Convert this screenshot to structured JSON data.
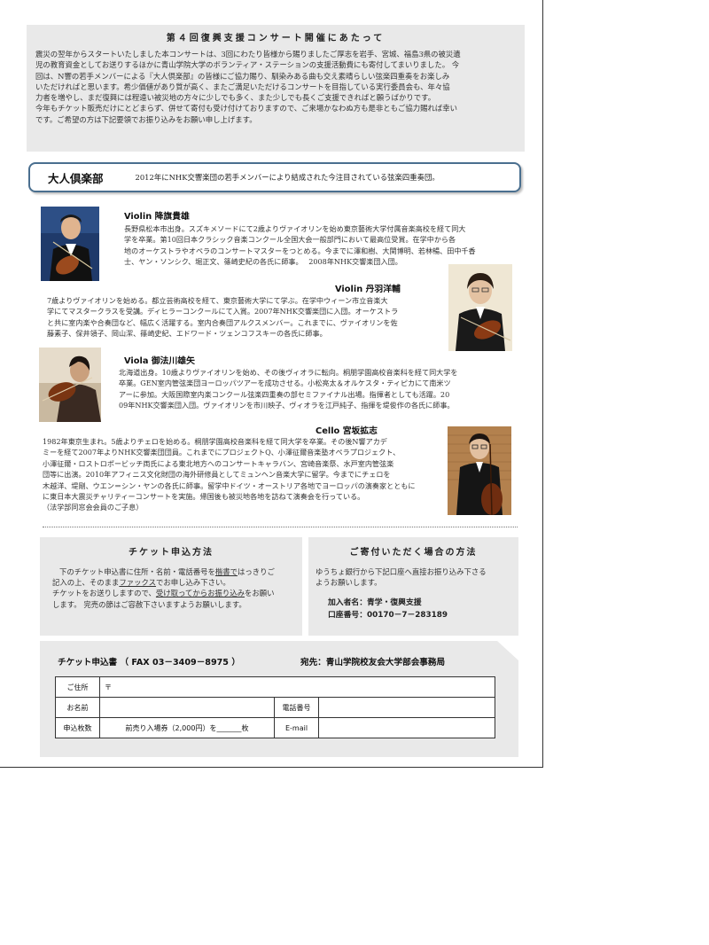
{
  "intro": {
    "title": "第４回復興支援コンサート開催にあたって",
    "lines": [
      "震災の翌年からスタートいたしました本コンサートは、3回にわたり皆様から賜りましたご厚志を岩手、宮城、福島3県の被災遺",
      "児の教育資金としてお送りするほかに青山学院大学のボランティア・ステーションの支援活動費にも寄付してまいりました。 今",
      "回は、N響の若手メンバーによる『大人倶楽部』の皆様にご協力賜り、馴染みある曲も交え素晴らしい弦楽四重奏をお楽しみ",
      "いただければと思います。希少価値があり質が高く、またご満足いただけるコンサートを目指している実行委員会も、年々協",
      "力者を増やし、まだ復興には程遠い被災地の方々に少しでも多く、また少しでも長くご支援できればと願うばかりです。",
      "今年もチケット販売だけにとどまらず、併せて寄付も受け付けておりますので、ご来場かなわぬ方も是非ともご協力賜れば幸い",
      "です。ご希望の方は下記要領でお振り込みをお願い申し上げます。"
    ]
  },
  "group": {
    "name": "大人倶楽部",
    "desc": "2012年にNHK交響楽団の若手メンバーにより結成された今注目されている弦楽四重奏団。"
  },
  "members": [
    {
      "name": "Violin  降旗貴雄",
      "lines": [
        "長野県松本市出身。スズキメソードにて2歳よりヴァイオリンを始め東京藝術大学付属音楽高校を経て同大",
        "学を卒業。第10回日本クラシック音楽コンクール全国大会一般部門において最高位受賞。在学中から各",
        "地のオーケストラやオペラのコンサートマスターをつとめる。今までに澤和樹、大関博明、若林暢、田中千香",
        "士、ヤン・ソンシク、堀正文、篠崎史紀の各氏に師事。　 2008年NHK交響楽団入団。"
      ]
    },
    {
      "name": "Violin  丹羽洋輔",
      "lines": [
        "7歳よりヴァイオリンを始める。都立芸術高校を経て、東京藝術大学にて学ぶ。在学中ウィーン市立音楽大",
        "学にてマスタークラスを受講。ディヒラーコンクールにて入賞。2007年NHK交響楽団に入団。オーケストラ",
        "と共に室内楽や合奏団など、幅広く活躍する。室内合奏団アルクスメンバー。これまでに、ヴァイオリンを佐",
        "藤素子、保井領子、岡山潔、篠崎史紀、エドワード・ツェンコフスキーの各氏に師事。"
      ]
    },
    {
      "name": "Viola  御法川雄矢",
      "lines": [
        "北海道出身。10歳よりヴァイオリンを始め、その後ヴィオラに転向。桐朋学園高校音楽科を経て同大学を",
        "卒業。GEN室内管弦楽団ヨーロッパツアーを成功させる。小松亮太＆オルケスタ・ティピカにて南米ツ",
        "アーに参加。大阪国際室内楽コンクール弦楽四重奏の部セミファイナル出場。指揮者としても活躍。20",
        "09年NHK交響楽団入団。ヴァイオリンを市川映子、ヴィオラを江戸純子、指揮を堤俊作の各氏に師事。"
      ]
    },
    {
      "name": "Cello  宮坂拡志",
      "lines": [
        "1982年東京生まれ。5歳よりチェロを始める。桐朋学園高校音楽科を経て同大学を卒業。その後N響アカデ",
        "ミーを経て2007年よりNHK交響楽団団員。これまでにプロジェクトQ、小澤征爾音楽塾オペラプロジェクト、",
        "小澤征爾・ロストロポービッチ両氏による東北地方へのコンサートキャラバン、宮崎音楽祭、水戸室内管弦楽",
        "団等に出演。2010年アフィニス文化財団の海外研修員としてミュンヘン音楽大学に留学。今までにチェロを",
        "木越洋、堤剛、ウエン＝シン・ヤンの各氏に師事。留学中ドイツ・オーストリア各地でヨーロッパの演奏家とともに",
        "に東日本大震災チャリティーコンサートを実施。帰国後も被災地各地を訪ねて演奏会を行っている。",
        "（法学部同窓会会員のご子息）"
      ]
    }
  ],
  "ticket": {
    "title": "チケット申込方法",
    "line1_a": "下のチケット申込書に住所・名前・電話番号を",
    "line1_u": "楷書で",
    "line1_b": "はっきりご",
    "line2_a": "記入の上、そのまま",
    "line2_u": "ファックス",
    "line2_b": "でお申し込み下さい。",
    "line3_a": "チケットをお送りしますので、",
    "line3_u": "受け取ってからお振り込み",
    "line3_b": "をお願い",
    "line4": "します。 完売の節はご容赦下さいますようお願いします。"
  },
  "donation": {
    "title": "ご寄付いただく場合の方法",
    "line1": "ゆうちょ銀行から下記口座へ直接お振り込み下さる",
    "line2": "ようお願いします。",
    "account_name": "加入者名：青学・復興支援",
    "account_number": "口座番号：00170－7－283189"
  },
  "form": {
    "title": "チケット申込書 （ FAX 03－3409－8975 ）",
    "destination": "宛先：青山学院校友会大学部会事務局",
    "address_label": "ご住所",
    "address_mark": "〒",
    "name_label": "お名前",
    "phone_label": "電話番号",
    "qty_label": "申込枚数",
    "qty_text": "前売り入場券（2,000円）を_______枚",
    "email_label": "E-mail"
  }
}
